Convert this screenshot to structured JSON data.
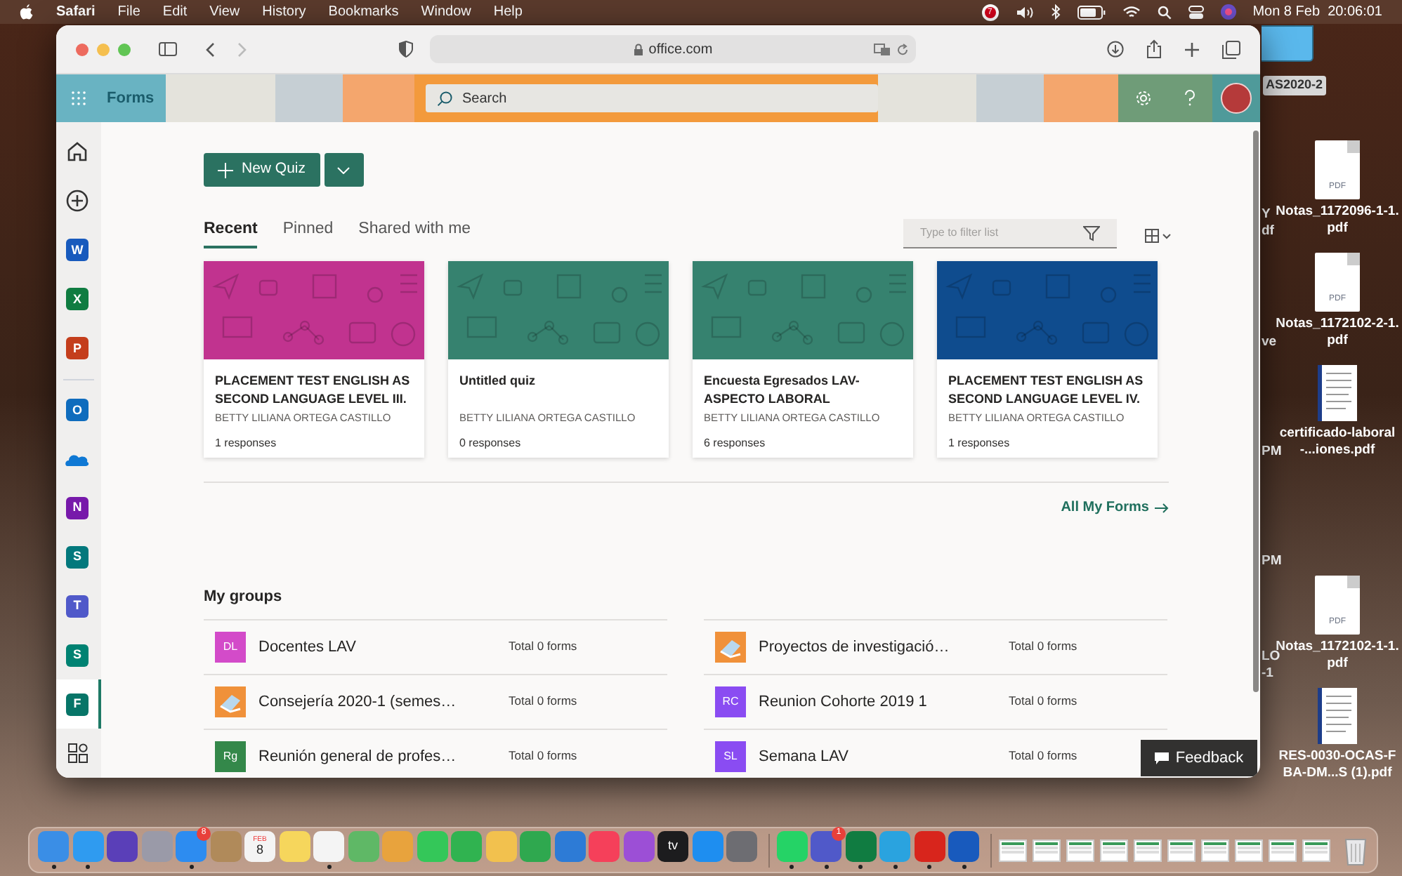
{
  "menu_bar": {
    "app": "Safari",
    "menus": [
      "File",
      "Edit",
      "View",
      "History",
      "Bookmarks",
      "Window",
      "Help"
    ],
    "notification_badge": "7",
    "clock": "Mon 8 Feb  20:06:01"
  },
  "browser": {
    "address": "office.com"
  },
  "header": {
    "app_name": "Forms",
    "search_placeholder": "Search"
  },
  "rail": [
    {
      "kind": "home",
      "selected": false
    },
    {
      "kind": "add",
      "selected": false
    },
    {
      "kind": "app",
      "letter": "W",
      "color": "#185abd",
      "selected": false
    },
    {
      "kind": "app",
      "letter": "X",
      "color": "#107c41",
      "selected": false
    },
    {
      "kind": "app",
      "letter": "P",
      "color": "#c43e1c",
      "selected": false
    },
    {
      "kind": "app",
      "letter": "O",
      "color": "#0f6cbd",
      "selected": false
    },
    {
      "kind": "cloud",
      "selected": false
    },
    {
      "kind": "app",
      "letter": "N",
      "color": "#7719aa",
      "selected": false
    },
    {
      "kind": "app",
      "letter": "S",
      "color": "#03787c",
      "selected": false
    },
    {
      "kind": "app",
      "letter": "T",
      "color": "#5059c9",
      "selected": false
    },
    {
      "kind": "app",
      "letter": "S",
      "color": "#008272",
      "selected": false
    },
    {
      "kind": "app",
      "letter": "F",
      "color": "#077568",
      "selected": true
    },
    {
      "kind": "apps",
      "selected": false
    }
  ],
  "new_button": "New Quiz",
  "tabs": [
    {
      "label": "Recent",
      "selected": true
    },
    {
      "label": "Pinned",
      "selected": false
    },
    {
      "label": "Shared with me",
      "selected": false
    }
  ],
  "filter_placeholder": "Type to filter list",
  "cards": [
    {
      "title": "PLACEMENT TEST ENGLISH AS SECOND LANGUAGE LEVEL III.",
      "owner": "BETTY LILIANA ORTEGA CASTILLO",
      "responses": "1 responses",
      "color": "#c1338f"
    },
    {
      "title": "Untitled quiz",
      "owner": "BETTY LILIANA ORTEGA CASTILLO",
      "responses": "0 responses",
      "color": "#36826f"
    },
    {
      "title": "Encuesta Egresados LAV-ASPECTO LABORAL",
      "owner": "BETTY LILIANA ORTEGA CASTILLO",
      "responses": "6 responses",
      "color": "#36826f"
    },
    {
      "title": "PLACEMENT TEST ENGLISH AS SECOND LANGUAGE LEVEL IV.",
      "owner": "BETTY LILIANA ORTEGA CASTILLO",
      "responses": "1 responses",
      "color": "#0f4c8e"
    }
  ],
  "all_forms_link": "All My Forms",
  "groups_heading": "My groups",
  "groups": [
    {
      "name": "Docentes LAV",
      "count": "Total 0 forms",
      "kind": "initials",
      "initials": "DL",
      "color": "#d34bc9"
    },
    {
      "name": "Proyectos de investigació…",
      "count": "Total 0 forms",
      "kind": "image",
      "color": "#f0913a"
    },
    {
      "name": "Consejería 2020-1 (semes…",
      "count": "Total 0 forms",
      "kind": "image",
      "color": "#f0913a"
    },
    {
      "name": "Reunion Cohorte 2019 1",
      "count": "Total 0 forms",
      "kind": "initials",
      "initials": "RC",
      "color": "#8a4cf2"
    },
    {
      "name": "Reunión general de profes…",
      "count": "Total 0 forms",
      "kind": "initials",
      "initials": "Rg",
      "color": "#34884a"
    },
    {
      "name": "Semana LAV",
      "count": "Total 0 forms",
      "kind": "initials",
      "initials": "SL",
      "color": "#8a4cf2"
    }
  ],
  "feedback": "Feedback",
  "desktop": {
    "folder_label": "AS2020-2",
    "cut_labels": [
      "Y",
      "df",
      "ve",
      "PM",
      "PM",
      "LO",
      "-1"
    ],
    "files": [
      {
        "name": "Notas_1172096-1-1.pdf",
        "kind": "pdf",
        "tag": "PDF"
      },
      {
        "name": "Notas_1172102-2-1.pdf",
        "kind": "pdf",
        "tag": "PDF"
      },
      {
        "name": "certificado-laboral-...iones.pdf",
        "kind": "doc"
      },
      {
        "name": "Notas_1172102-1-1.pdf",
        "kind": "pdf",
        "tag": "PDF"
      },
      {
        "name": "RES-0030-OCAS-FBA-DM...S (1).pdf",
        "kind": "doc"
      }
    ]
  },
  "dock": [
    {
      "color": "#3a8ee6",
      "running": true
    },
    {
      "color": "#2f9bf0",
      "running": true
    },
    {
      "color": "#5a3fb8",
      "running": false
    },
    {
      "color": "#9a9aa8",
      "running": false
    },
    {
      "color": "#2d8cf0",
      "running": true,
      "badge": "8"
    },
    {
      "color": "#b08a5a",
      "running": false
    },
    {
      "color": "#f4f4f4",
      "running": false,
      "text": "8",
      "month": "FEB"
    },
    {
      "color": "#f6d65c",
      "running": false
    },
    {
      "color": "#f4f4f4",
      "running": true
    },
    {
      "color": "#5fb866",
      "running": false
    },
    {
      "color": "#e8a33d",
      "running": false
    },
    {
      "color": "#34c759",
      "running": false
    },
    {
      "color": "#30b350",
      "running": false
    },
    {
      "color": "#f2c14e",
      "running": false
    },
    {
      "color": "#2fa84f",
      "running": false
    },
    {
      "color": "#2d7bd6",
      "running": false
    },
    {
      "color": "#f5405a",
      "running": false
    },
    {
      "color": "#9c4fd6",
      "running": false
    },
    {
      "color": "#1c1c1e",
      "running": false,
      "text": "tv"
    },
    {
      "color": "#1e8ef0",
      "running": false
    },
    {
      "color": "#6d6d72",
      "running": false
    },
    {
      "color": "#25d366",
      "running": true
    },
    {
      "color": "#5059c9",
      "running": true,
      "badge": "1"
    },
    {
      "color": "#107c41",
      "running": true
    },
    {
      "color": "#2aa3df",
      "running": true
    },
    {
      "color": "#d8251c",
      "running": true
    },
    {
      "color": "#185abd",
      "running": true
    }
  ]
}
